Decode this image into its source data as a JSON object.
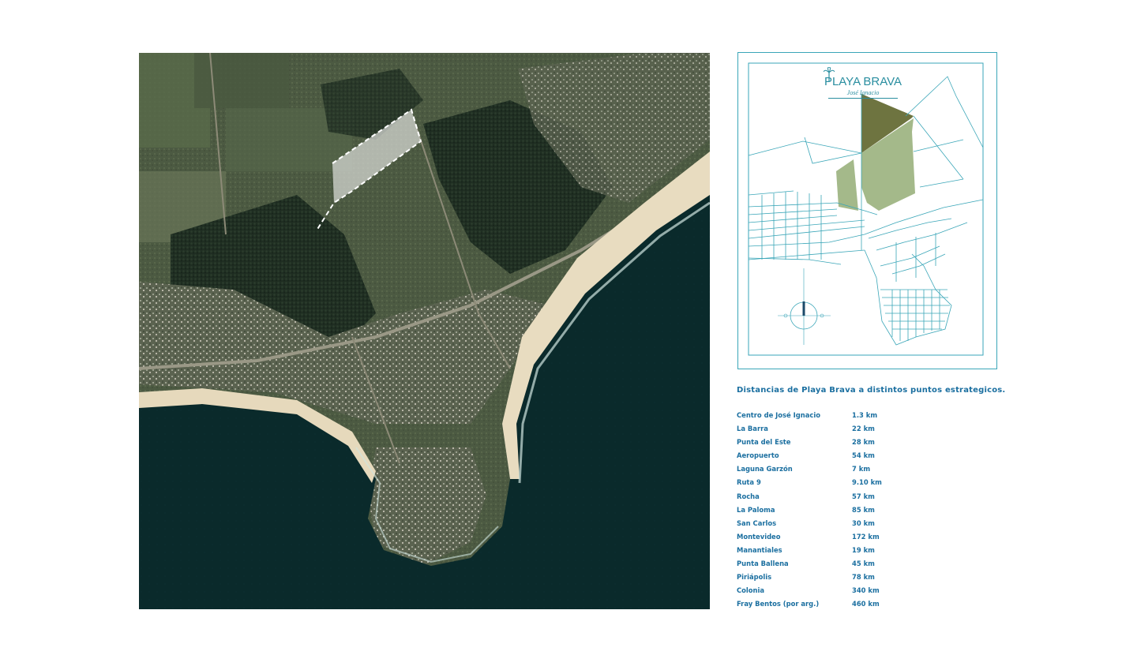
{
  "map": {
    "aerial": {
      "site_outline": "dashed white",
      "ocean_color": "#0b2b2b",
      "beach_color": "#e8dcc0"
    },
    "plan": {
      "frame_color": "#3aa6b8",
      "lot_dark_color": "#6e7440",
      "lot_light_color": "#a4b98a",
      "compass_icon": "compass-rose-icon"
    }
  },
  "logo": {
    "brand": "PLAYA BRAVA",
    "sub": "José Ignacio",
    "icon": "palm-tree-icon"
  },
  "distances": {
    "title": "Distancias de Playa Brava a distintos puntos estrategicos.",
    "items": [
      {
        "place": "Centro de José Ignacio",
        "km": "1.3 km"
      },
      {
        "place": "La Barra",
        "km": "22 km"
      },
      {
        "place": "Punta del Este",
        "km": "28 km"
      },
      {
        "place": "Aeropuerto",
        "km": "54 km"
      },
      {
        "place": "Laguna Garzón",
        "km": "7 km"
      },
      {
        "place": "Ruta 9",
        "km": "9.10 km"
      },
      {
        "place": "Rocha",
        "km": "57 km"
      },
      {
        "place": "La Paloma",
        "km": "85 km"
      },
      {
        "place": "San Carlos",
        "km": "30 km"
      },
      {
        "place": "Montevideo",
        "km": "172 km"
      },
      {
        "place": "Manantiales",
        "km": "19 km"
      },
      {
        "place": "Punta Ballena",
        "km": "45 km"
      },
      {
        "place": "Piriápolis",
        "km": "78 km"
      },
      {
        "place": "Colonia",
        "km": "340 km"
      },
      {
        "place": "Fray Bentos (por arg.)",
        "km": "460 km"
      }
    ]
  }
}
